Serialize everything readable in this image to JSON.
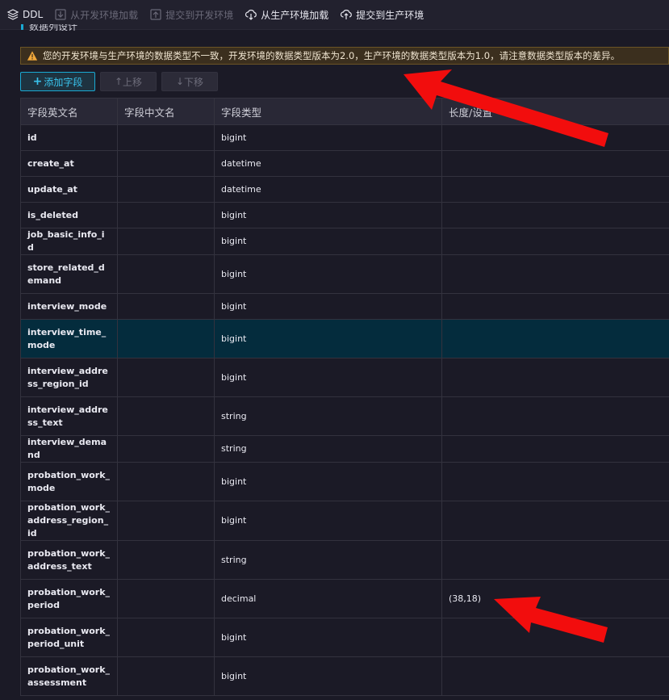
{
  "toolbar": {
    "ddl_label": "DDL",
    "load_from_dev": "从开发环境加载",
    "submit_to_dev": "提交到开发环境",
    "load_from_prod": "从生产环境加载",
    "submit_to_prod": "提交到生产环境"
  },
  "section": {
    "title": "数据列设计"
  },
  "alert": {
    "text": "您的开发环境与生产环境的数据类型不一致，开发环境的数据类型版本为2.0，生产环境的数据类型版本为1.0，请注意数据类型版本的差异。",
    "color": "#f2a93b"
  },
  "actions": {
    "add_field": "添加字段",
    "move_up": "上移",
    "move_down": "下移"
  },
  "table": {
    "headers": [
      "字段英文名",
      "字段中文名",
      "字段类型",
      "长度/设置"
    ],
    "rows": [
      {
        "name": "id",
        "cn": "",
        "type": "bigint",
        "len": ""
      },
      {
        "name": "create_at",
        "cn": "",
        "type": "datetime",
        "len": ""
      },
      {
        "name": "update_at",
        "cn": "",
        "type": "datetime",
        "len": ""
      },
      {
        "name": "is_deleted",
        "cn": "",
        "type": "bigint",
        "len": ""
      },
      {
        "name": "job_basic_info_id",
        "cn": "",
        "type": "bigint",
        "len": ""
      },
      {
        "name": "store_related_demand",
        "cn": "",
        "type": "bigint",
        "len": ""
      },
      {
        "name": "interview_mode",
        "cn": "",
        "type": "bigint",
        "len": ""
      },
      {
        "name": "interview_time_mode",
        "cn": "",
        "type": "bigint",
        "len": ""
      },
      {
        "name": "interview_address_region_id",
        "cn": "",
        "type": "bigint",
        "len": ""
      },
      {
        "name": "interview_address_text",
        "cn": "",
        "type": "string",
        "len": ""
      },
      {
        "name": "interview_demand",
        "cn": "",
        "type": "string",
        "len": ""
      },
      {
        "name": "probation_work_mode",
        "cn": "",
        "type": "bigint",
        "len": ""
      },
      {
        "name": "probation_work_address_region_id",
        "cn": "",
        "type": "bigint",
        "len": ""
      },
      {
        "name": "probation_work_address_text",
        "cn": "",
        "type": "string",
        "len": ""
      },
      {
        "name": "probation_work_period",
        "cn": "",
        "type": "decimal",
        "len": "(38,18)"
      },
      {
        "name": "probation_work_period_unit",
        "cn": "",
        "type": "bigint",
        "len": ""
      },
      {
        "name": "probation_work_assessment",
        "cn": "",
        "type": "bigint",
        "len": ""
      }
    ],
    "selected_row": "interview_time_mode"
  },
  "annotation_color": "#f20d0d"
}
